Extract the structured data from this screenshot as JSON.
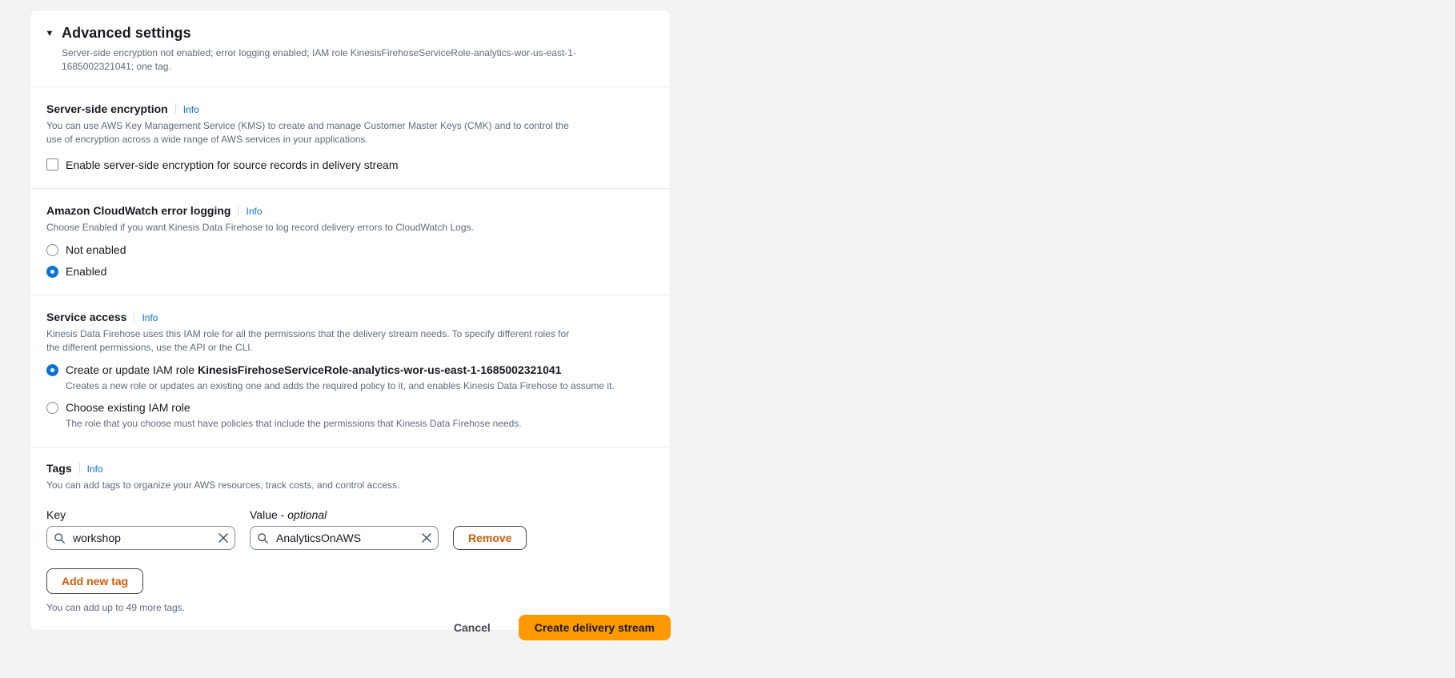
{
  "header": {
    "title": "Advanced settings",
    "summary": "Server-side encryption not enabled; error logging enabled; IAM role KinesisFirehoseServiceRole-analytics-wor-us-east-1-1685002321041; one tag.",
    "caret": "▼"
  },
  "info_label": "Info",
  "encryption": {
    "title": "Server-side encryption",
    "description": "You can use AWS Key Management Service (KMS) to create and manage Customer Master Keys (CMK) and to control the use of encryption across a wide range of AWS services in your applications.",
    "checkbox_label": "Enable server-side encryption for source records in delivery stream",
    "checked": false
  },
  "error_logging": {
    "title": "Amazon CloudWatch error logging",
    "description": "Choose Enabled if you want Kinesis Data Firehose to log record delivery errors to CloudWatch Logs.",
    "options": [
      {
        "label": "Not enabled",
        "selected": false
      },
      {
        "label": "Enabled",
        "selected": true
      }
    ]
  },
  "service_access": {
    "title": "Service access",
    "description": "Kinesis Data Firehose uses this IAM role for all the permissions that the delivery stream needs. To specify different roles for the different permissions, use the API or the CLI.",
    "options": [
      {
        "label_prefix": "Create or update IAM role ",
        "label_strong": "KinesisFirehoseServiceRole-analytics-wor-us-east-1-1685002321041",
        "description": "Creates a new role or updates an existing one and adds the required policy to it, and enables Kinesis Data Firehose to assume it.",
        "selected": true
      },
      {
        "label_prefix": "Choose existing IAM role",
        "label_strong": "",
        "description": "The role that you choose must have policies that include the permissions that Kinesis Data Firehose needs.",
        "selected": false
      }
    ]
  },
  "tags": {
    "title": "Tags",
    "description": "You can add tags to organize your AWS resources, track costs, and control access.",
    "key_header": "Key",
    "value_header_text": "Value - ",
    "value_header_optional": "optional",
    "rows": [
      {
        "key_value": "workshop",
        "value_value": "AnalyticsOnAWS",
        "remove_label": "Remove"
      }
    ],
    "add_label": "Add new tag",
    "note": "You can add up to 49 more tags."
  },
  "footer": {
    "cancel_label": "Cancel",
    "primary_label": "Create delivery stream"
  },
  "colors": {
    "accent_link": "#0972d3",
    "primary_button": "#ff9900",
    "button_text_orange": "#d45b07",
    "panel_bg": "#ffffff",
    "page_bg": "#f2f3f3",
    "muted_text": "#5f6b7a"
  }
}
